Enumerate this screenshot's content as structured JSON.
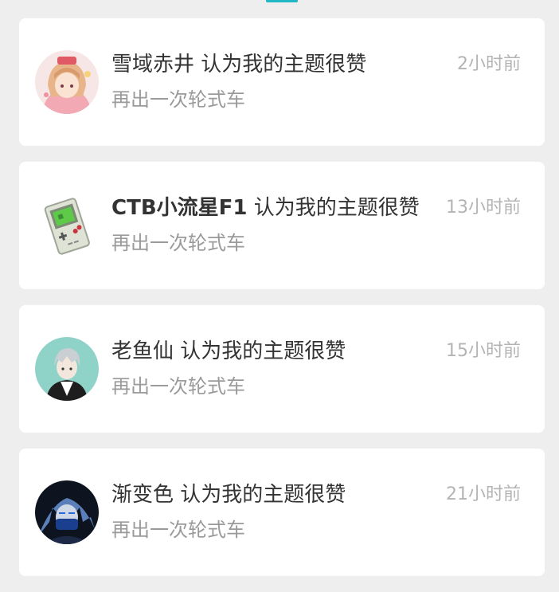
{
  "colors": {
    "accent": "#1fb8c4",
    "background": "#eeeeee",
    "card": "#ffffff",
    "title_text": "#333333",
    "subtitle_text": "#9a9a9a",
    "time_text": "#b4b4b4"
  },
  "notifications": [
    {
      "avatar": "anime-girl-avatar",
      "username": "雪域赤井",
      "action": " 认为我的主题很赞",
      "topic": "再出一次轮式车",
      "time": "2小时前"
    },
    {
      "avatar": "gameboy-avatar",
      "username": "CTB小流星F1",
      "action": " 认为我的主题很赞",
      "topic": "再出一次轮式车",
      "time": "13小时前"
    },
    {
      "avatar": "silver-hair-character-avatar",
      "username": "老鱼仙",
      "action": " 认为我的主题很赞",
      "topic": "再出一次轮式车",
      "time": "15小时前"
    },
    {
      "avatar": "masked-character-avatar",
      "username": "渐变色",
      "action": " 认为我的主题很赞",
      "topic": "再出一次轮式车",
      "time": "21小时前"
    }
  ]
}
